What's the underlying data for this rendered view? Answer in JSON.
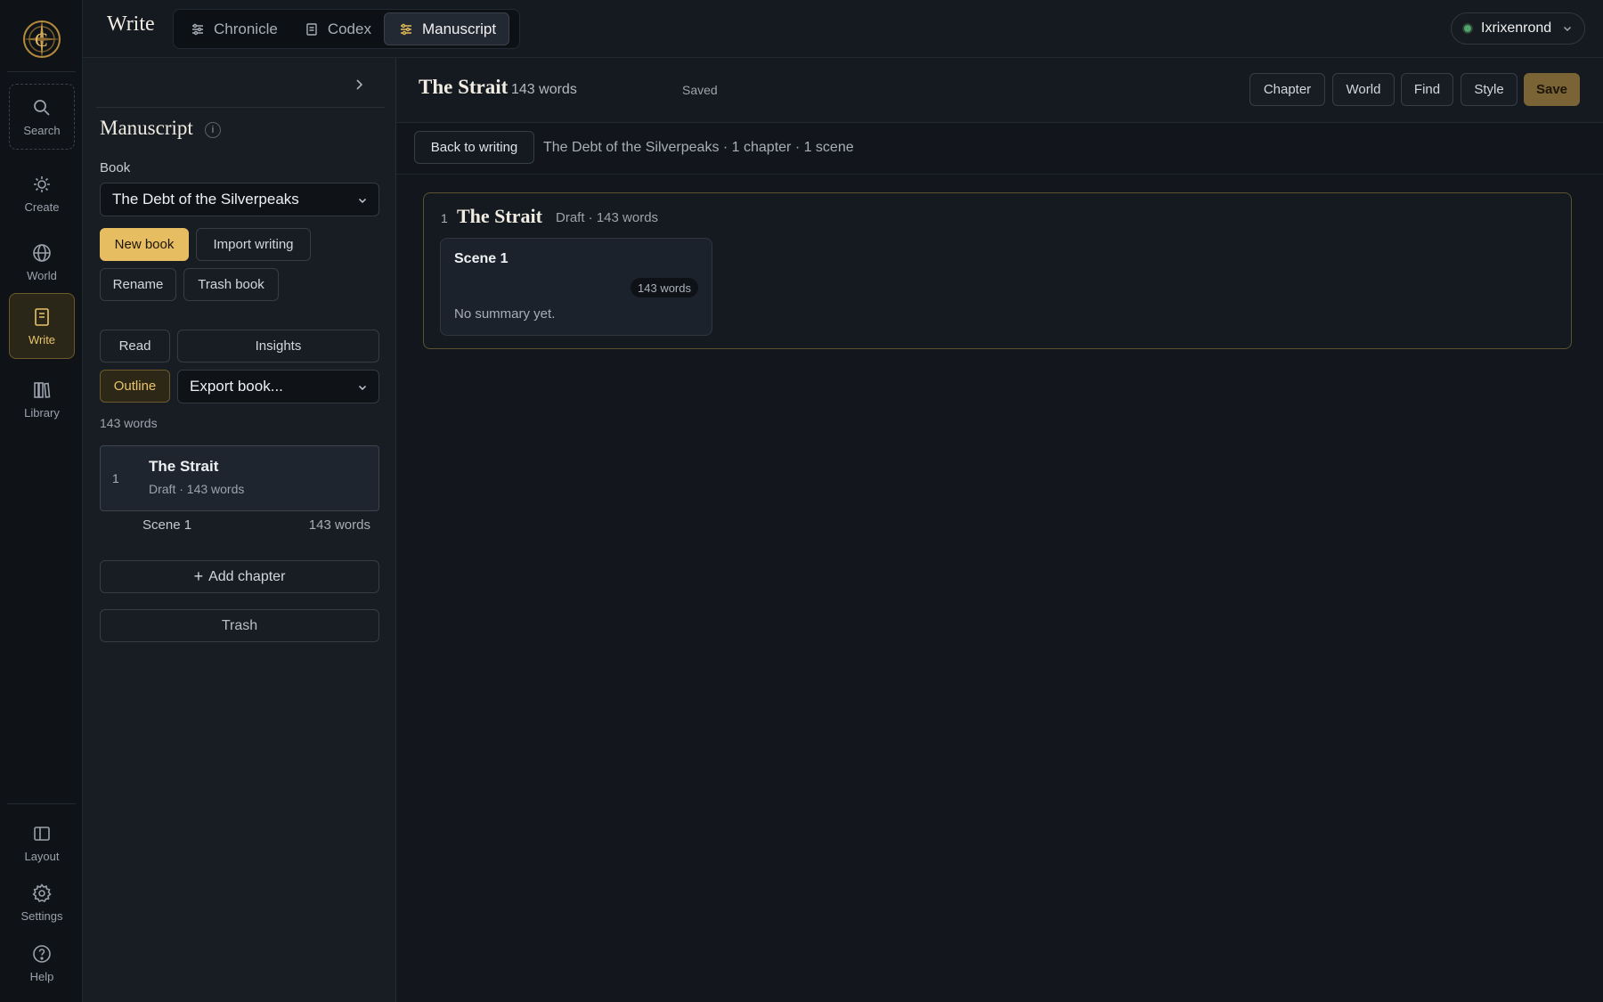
{
  "app": {
    "section_title": "Write"
  },
  "mode_tabs": [
    {
      "label": "Chronicle",
      "icon": "sliders-icon"
    },
    {
      "label": "Codex",
      "icon": "document-icon"
    },
    {
      "label": "Manuscript",
      "icon": "sliders-icon",
      "active": true
    }
  ],
  "user": {
    "name": "Ixrixenrond",
    "status_color": "#55a36c"
  },
  "rail": {
    "top": [
      {
        "label": "Search",
        "icon": "search-icon"
      },
      {
        "label": "Create",
        "icon": "sparkle-icon"
      },
      {
        "label": "World",
        "icon": "globe-icon"
      },
      {
        "label": "Write",
        "icon": "book-icon",
        "active": true
      },
      {
        "label": "Library",
        "icon": "books-icon"
      }
    ],
    "bottom": [
      {
        "label": "Layout",
        "icon": "layout-icon"
      },
      {
        "label": "Settings",
        "icon": "gear-icon"
      },
      {
        "label": "Help",
        "icon": "help-icon"
      }
    ]
  },
  "sidebar": {
    "title": "Manuscript",
    "info_glyph": "i",
    "book_label": "Book",
    "book_selected": "The Debt of the Silverpeaks",
    "buttons": {
      "new_book": "New book",
      "import_writing": "Import writing",
      "rename": "Rename",
      "trash_book": "Trash book",
      "read": "Read",
      "insights": "Insights",
      "outline": "Outline",
      "add_chapter": "Add chapter",
      "trash": "Trash"
    },
    "export_selected": "Export book...",
    "total_words": "143 words",
    "chapters": [
      {
        "number": "1",
        "title": "The Strait",
        "meta": "Draft · 143 words",
        "scenes": [
          {
            "title": "Scene 1",
            "words": "143 words"
          }
        ]
      }
    ]
  },
  "main": {
    "title": "The Strait",
    "word_count": "143 words",
    "save_status": "Saved",
    "header_buttons": {
      "chapter": "Chapter",
      "world": "World",
      "find": "Find",
      "style": "Style",
      "save": "Save"
    },
    "back_label": "Back to writing",
    "context": "The Debt of the Silverpeaks · 1 chapter · 1 scene",
    "chapter_panel": {
      "number": "1",
      "title": "The Strait",
      "meta": "Draft · 143 words",
      "scene": {
        "title": "Scene 1",
        "words": "143 words",
        "summary": "No summary yet."
      }
    }
  },
  "colors": {
    "accent": "#e7bd62",
    "background": "#13171d",
    "active_rail": "#2a2618"
  }
}
